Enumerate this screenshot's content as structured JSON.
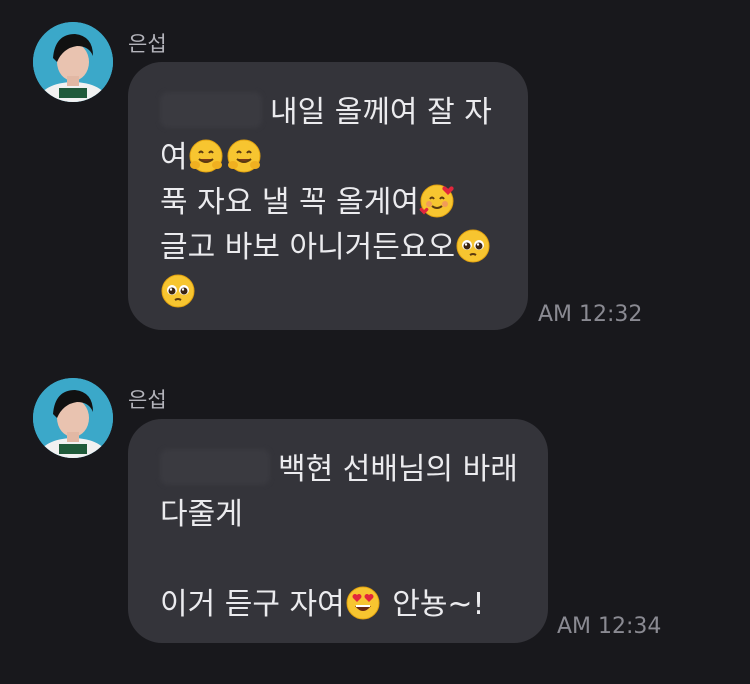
{
  "messages": [
    {
      "sender": "은섭",
      "lines": [
        {
          "text": "내일 올께여 잘 자"
        },
        {
          "text": "여"
        },
        {
          "text": "푹 자요 낼 꼭 올게여"
        },
        {
          "text": "글고 바보 아니거든요오"
        }
      ],
      "time": "AM 12:32"
    },
    {
      "sender": "은섭",
      "lines": [
        {
          "text": "백현 선배님의 바래"
        },
        {
          "text": "다줄게"
        },
        {
          "text": "이거 듣구 자여"
        },
        {
          "text": " 안뇽~!"
        }
      ],
      "time": "AM 12:34"
    }
  ],
  "emoji_names": {
    "hug": "hugging-face-emoji",
    "hearts": "smiling-face-with-hearts-emoji",
    "pleading": "pleading-face-emoji",
    "heart_eyes": "heart-eyes-emoji"
  },
  "colors": {
    "background": "#18181c",
    "bubble": "#34343a",
    "text": "#ebebee",
    "sender": "#b4b4bb",
    "time": "#8a8a92"
  }
}
